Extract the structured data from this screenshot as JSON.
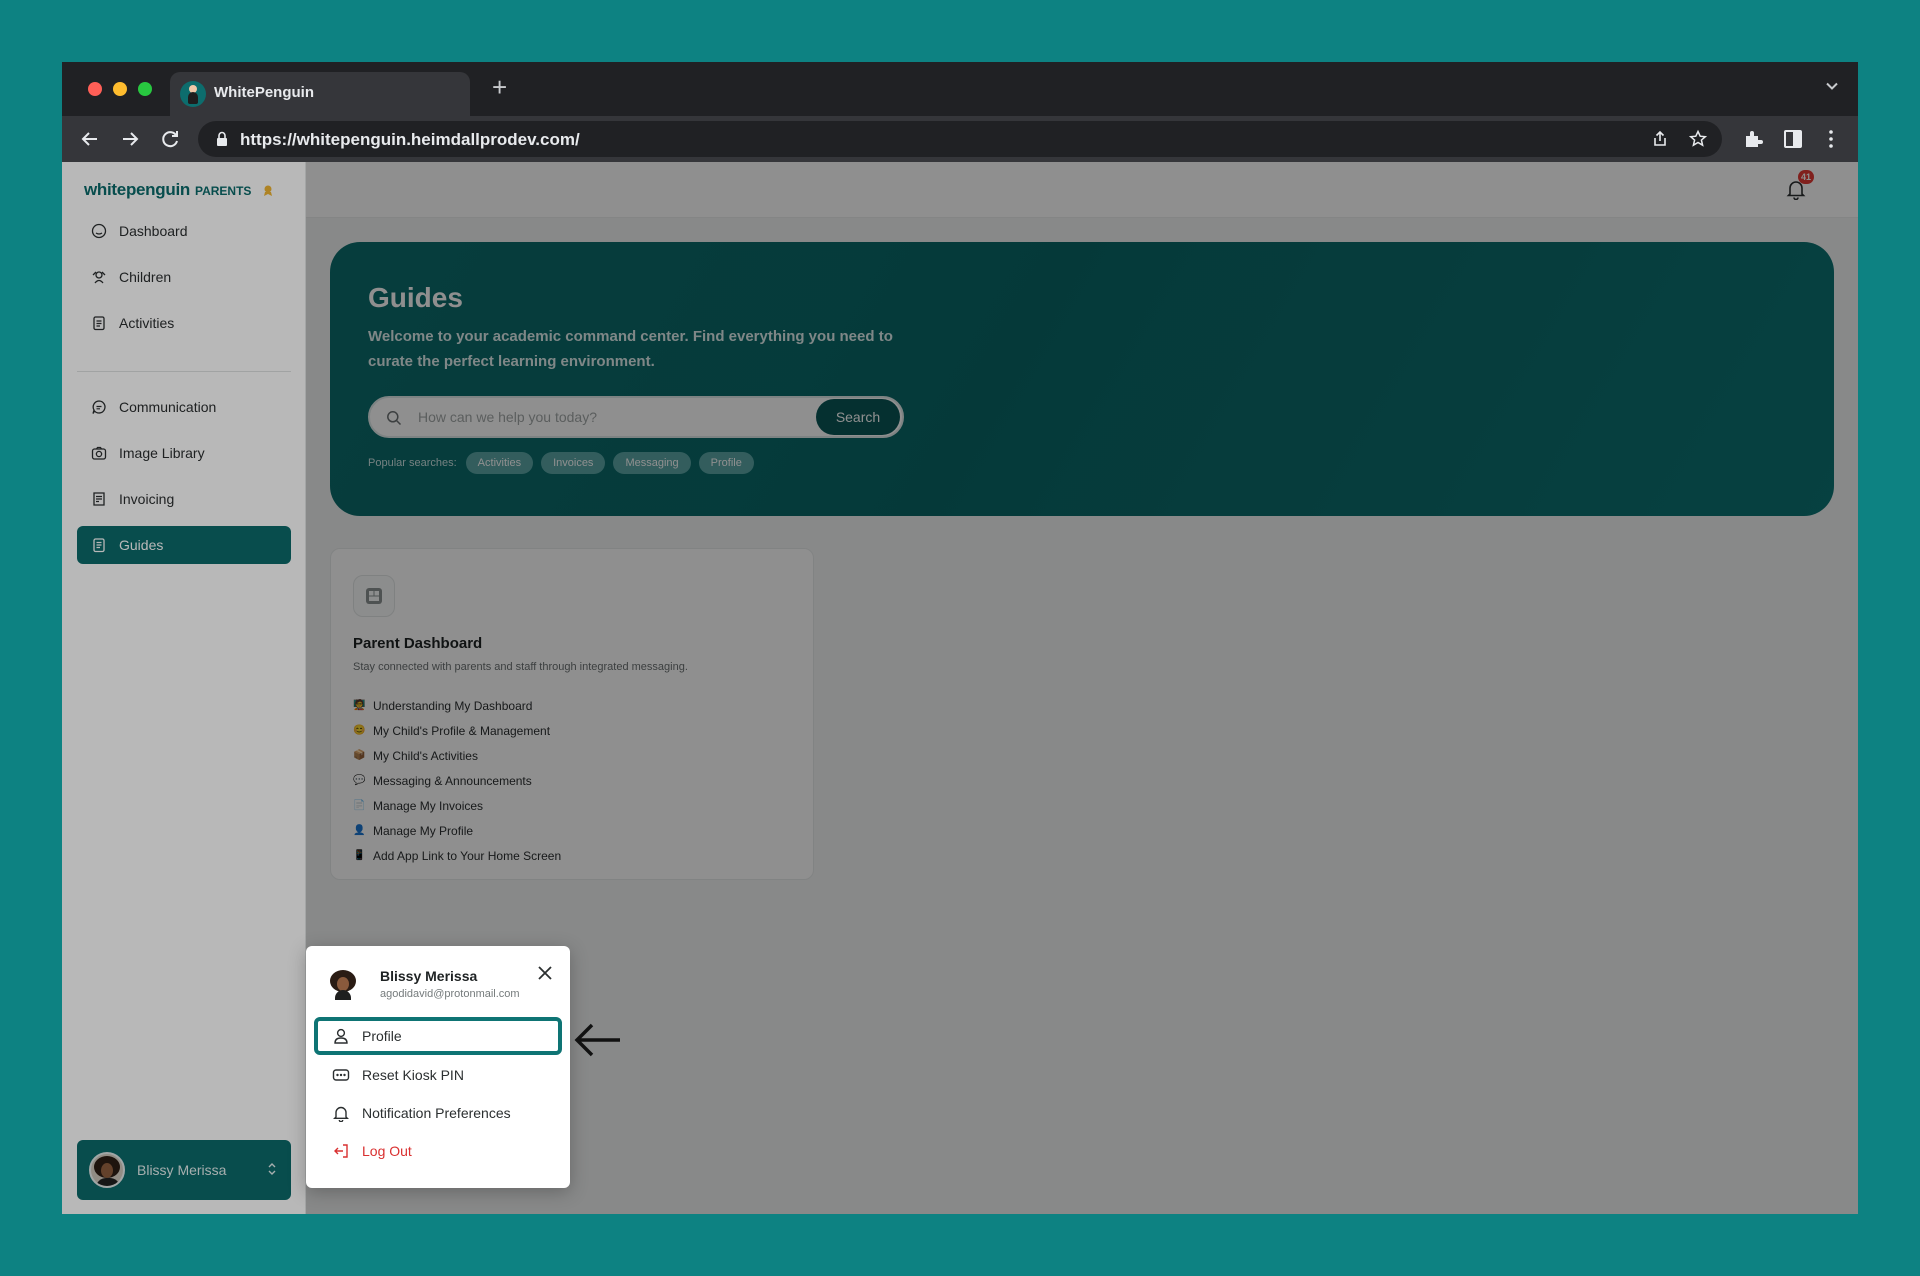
{
  "browser": {
    "tab_title": "WhitePenguin",
    "url": "https://whitepenguin.heimdallprodev.com/"
  },
  "brand": {
    "logo_main": "whitepenguin",
    "logo_sub": "PARENTS",
    "accent_color": "#0c6b6b"
  },
  "sidebar": {
    "items": [
      {
        "label": "Dashboard",
        "icon": "dashboard-icon"
      },
      {
        "label": "Children",
        "icon": "children-icon"
      },
      {
        "label": "Activities",
        "icon": "activities-icon"
      },
      {
        "label": "Communication",
        "icon": "chat-icon"
      },
      {
        "label": "Image Library",
        "icon": "camera-icon"
      },
      {
        "label": "Invoicing",
        "icon": "invoice-icon"
      },
      {
        "label": "Guides",
        "icon": "guides-icon",
        "active": true
      }
    ],
    "user_name": "Blissy Merissa"
  },
  "topbar": {
    "notification_count": "41"
  },
  "hero": {
    "title": "Guides",
    "subtitle": "Welcome to your academic command center. Find everything you need to curate the perfect learning environment.",
    "search_placeholder": "How can we help you today?",
    "search_button": "Search",
    "popular_label": "Popular searches:",
    "popular_chips": [
      "Activities",
      "Invoices",
      "Messaging",
      "Profile"
    ]
  },
  "guide_card": {
    "title": "Parent Dashboard",
    "description": "Stay connected with parents and staff through integrated messaging.",
    "items": [
      {
        "emoji": "🧑‍🏫",
        "label": "Understanding My Dashboard"
      },
      {
        "emoji": "😊",
        "label": "My Child's Profile & Management"
      },
      {
        "emoji": "📦",
        "label": "My Child's Activities"
      },
      {
        "emoji": "💬",
        "label": "Messaging & Announcements"
      },
      {
        "emoji": "📄",
        "label": "Manage My Invoices"
      },
      {
        "emoji": "👤",
        "label": "Manage My Profile"
      },
      {
        "emoji": "📱",
        "label": "Add App Link to Your Home Screen"
      }
    ]
  },
  "profile_menu": {
    "name": "Blissy Merissa",
    "email": "agodidavid@protonmail.com",
    "items": [
      {
        "label": "Profile",
        "icon": "user-icon"
      },
      {
        "label": "Reset Kiosk PIN",
        "icon": "pin-icon"
      },
      {
        "label": "Notification Preferences",
        "icon": "bell-icon"
      },
      {
        "label": "Log Out",
        "icon": "logout-icon"
      }
    ]
  }
}
